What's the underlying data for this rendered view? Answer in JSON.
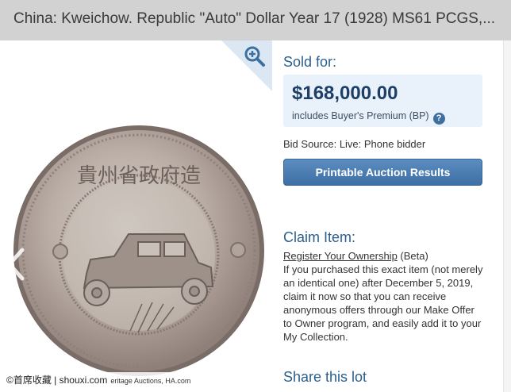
{
  "title": "China: Kweichow. Republic \"Auto\" Dollar Year 17 (1928) MS61 PCGS,...",
  "image": {
    "coin_chars_top": "貴州省政府造",
    "watermark_site": "©首席收藏 | shouxi.com",
    "watermark_credit": "eritage Auctions, HA.com"
  },
  "sale": {
    "sold_for_label": "Sold for:",
    "price": "$168,000.00",
    "premium_note": "includes Buyer's Premium (BP)",
    "help_glyph": "?",
    "bid_source": "Bid Source: Live: Phone bidder",
    "print_button": "Printable Auction Results"
  },
  "claim": {
    "title": "Claim Item:",
    "register_link": "Register Your Ownership",
    "beta": " (Beta)",
    "body": "If you purchased this exact item (not merely an identical one) after December 5, 2019, claim it now so that you can receive anonymous offers through our Make Offer to Owner program, and easily add it to your My Collection."
  },
  "share_title": "Share this lot",
  "colors": {
    "accent": "#2c5f8c",
    "price_box": "#e9f1fb",
    "button": "#4a7bb1",
    "title_bar": "#d2d2d2"
  }
}
